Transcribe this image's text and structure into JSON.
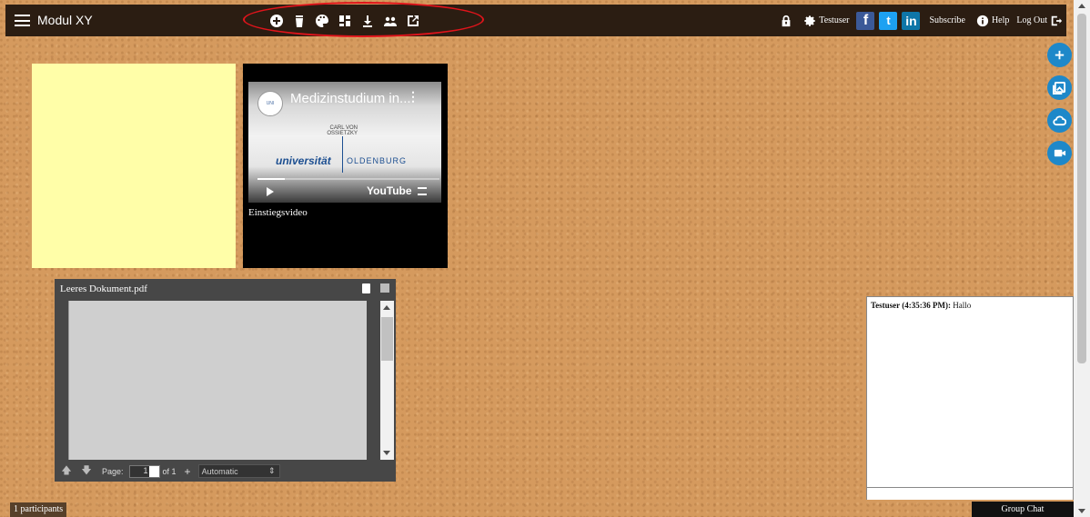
{
  "app": {
    "title": "Modul XY"
  },
  "toolbar": {
    "items": [
      "add-icon",
      "trash-icon",
      "palette-icon",
      "layout-icon",
      "download-icon",
      "users-icon",
      "external-link-icon"
    ]
  },
  "user": {
    "name": "Testuser",
    "subscribe_label": "Subscribe",
    "help_label": "Help",
    "logout_label": "Log Out"
  },
  "social": {
    "facebook": "f",
    "twitter": "t",
    "linkedin": "in"
  },
  "video": {
    "title": "Medizinstudium in...",
    "caption": "Einstiegsvideo",
    "uni_small": "CARL VON OSSIETZKY",
    "uni_main": "universität",
    "uni_place": "OLDENBURG",
    "player_brand": "YouTube"
  },
  "pdf": {
    "filename": "Leeres Dokument.pdf",
    "page_label": "Page:",
    "page_value": "1",
    "of_label": "of 1",
    "zoom_value": "Automatic"
  },
  "chat": {
    "sender": "Testuser (4:35:36 PM):",
    "message": "Hallo",
    "group_label": "Group Chat"
  },
  "participants": {
    "label": "1 participants"
  },
  "colors": {
    "accent": "#1e88c9",
    "topbar": "#2b1d12",
    "sticky": "#fffea8",
    "highlight": "#e0141b"
  }
}
